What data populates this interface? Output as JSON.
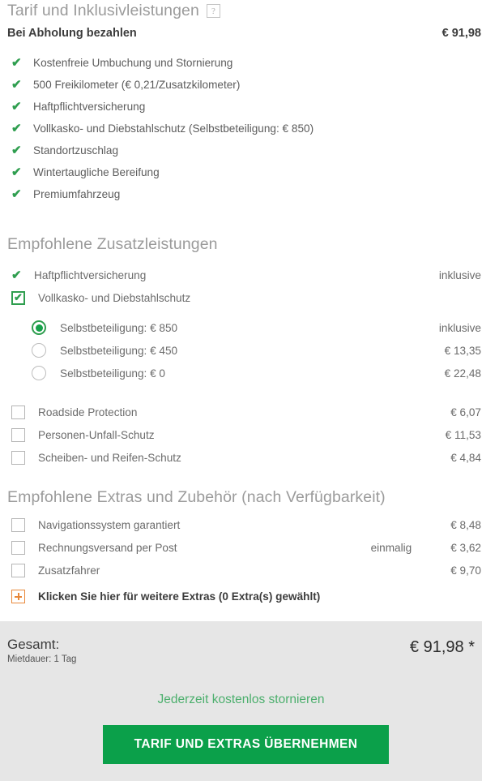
{
  "header": {
    "title": "Tarif und Inklusivleistungen",
    "help_badge": "?"
  },
  "pay_on_pickup": {
    "label": "Bei Abholung bezahlen",
    "price": "€ 91,98"
  },
  "included": {
    "items": [
      {
        "label": "Kostenfreie Umbuchung und Stornierung"
      },
      {
        "label": "500 Freikilometer (€ 0,21/Zusatzkilometer)"
      },
      {
        "label": "Haftpflichtversicherung"
      },
      {
        "label": "Vollkasko- und Diebstahlschutz (Selbstbeteiligung: € 850)"
      },
      {
        "label": "Standortzuschlag"
      },
      {
        "label": "Wintertaugliche Bereifung"
      },
      {
        "label": "Premiumfahrzeug"
      }
    ]
  },
  "addons": {
    "heading": "Empfohlene Zusatzleistungen",
    "items": [
      {
        "label": "Haftpflichtversicherung",
        "price": "inklusive"
      },
      {
        "label": "Vollkasko- und Diebstahlschutz",
        "price": ""
      }
    ],
    "deductible_options": [
      {
        "label": "Selbstbeteiligung: € 850",
        "price": "inklusive"
      },
      {
        "label": "Selbstbeteiligung: € 450",
        "price": "€ 13,35"
      },
      {
        "label": "Selbstbeteiligung: € 0",
        "price": "€ 22,48"
      }
    ],
    "optional_items": [
      {
        "label": "Roadside Protection",
        "price": "€ 6,07"
      },
      {
        "label": "Personen-Unfall-Schutz",
        "price": "€ 11,53"
      },
      {
        "label": "Scheiben- und Reifen-Schutz",
        "price": "€ 4,84"
      }
    ]
  },
  "extras": {
    "heading": "Empfohlene Extras und Zubehör (nach Verfügbarkeit)",
    "items": [
      {
        "label": "Navigationssystem garantiert",
        "note": "",
        "price": "€ 8,48"
      },
      {
        "label": "Rechnungsversand per Post",
        "note": "einmalig",
        "price": "€ 3,62"
      },
      {
        "label": "Zusatzfahrer",
        "note": "",
        "price": "€ 9,70"
      }
    ],
    "more_link": "Klicken Sie hier für weitere Extras (0 Extra(s) gewählt)"
  },
  "total": {
    "label": "Gesamt:",
    "duration": "Mietdauer: 1 Tag",
    "amount": "€ 91,98 *",
    "cancel_note": "Jederzeit kostenlos stornieren",
    "submit_label": "TARIF UND EXTRAS ÜBERNEHMEN"
  },
  "icons": {
    "check": "✔",
    "help": "?",
    "plus": "+"
  },
  "colors": {
    "green_check": "#2f9e4f",
    "button_green": "#0ba04a",
    "cancel_green": "#4caf6d",
    "orange_plus": "#e8883a",
    "panel_gray": "#e6e6e6",
    "heading_gray": "#9b9b9b"
  }
}
